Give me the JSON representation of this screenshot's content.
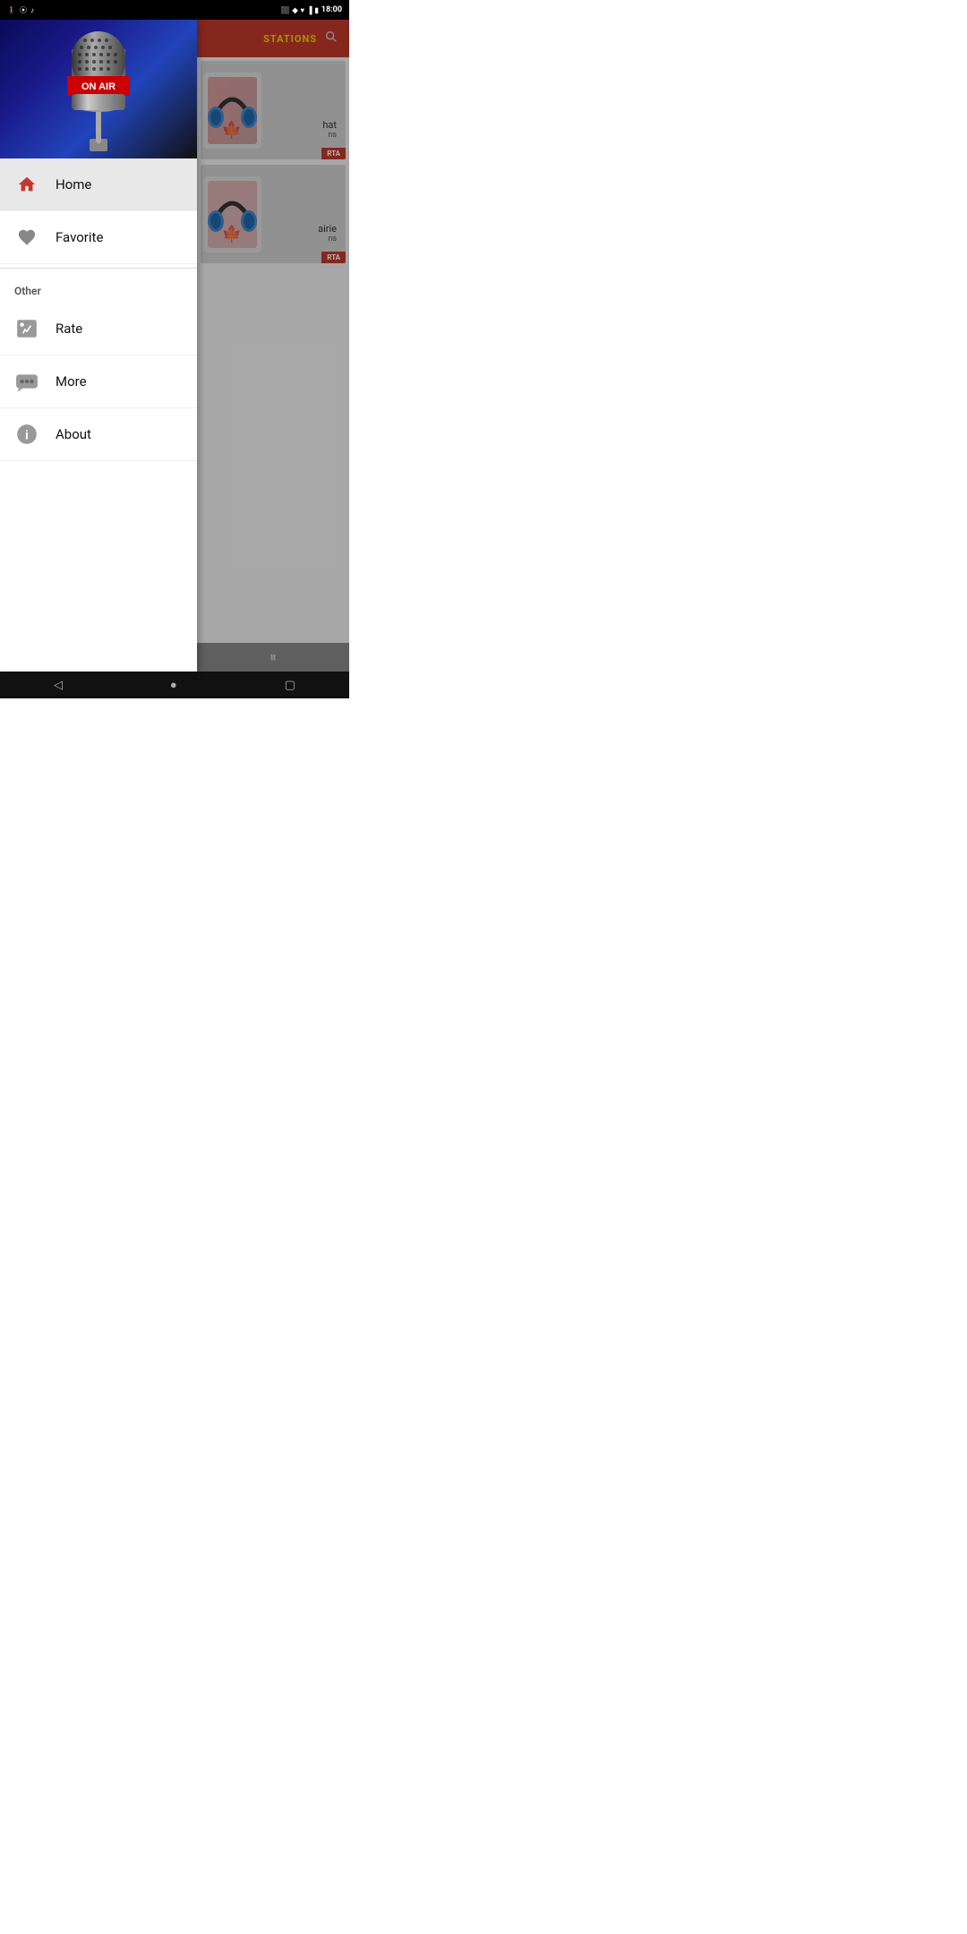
{
  "statusBar": {
    "time": "18:00",
    "icons": [
      "cast",
      "arrow-up",
      "wifi",
      "signal",
      "battery"
    ]
  },
  "drawer": {
    "heroAlt": "On Air Microphone",
    "menuItems": [
      {
        "id": "home",
        "label": "Home",
        "icon": "home",
        "active": true
      },
      {
        "id": "favorite",
        "label": "Favorite",
        "icon": "heart",
        "active": false
      }
    ],
    "sectionHeader": "Other",
    "otherItems": [
      {
        "id": "rate",
        "label": "Rate",
        "icon": "rate"
      },
      {
        "id": "more",
        "label": "More",
        "icon": "more"
      },
      {
        "id": "about",
        "label": "About",
        "icon": "info"
      }
    ]
  },
  "background": {
    "toolbarLabel": "STATIONS",
    "stations": [
      {
        "id": 1,
        "label": "RTA",
        "subtitle1": "hat",
        "subtitle2": "ns"
      },
      {
        "id": 2,
        "label": "RTA",
        "subtitle1": "airie",
        "subtitle2": "ns"
      }
    ]
  },
  "bottomNav": {
    "back": "◁",
    "home": "●",
    "recents": "▢"
  },
  "player": {
    "pauseLabel": "⏸"
  }
}
